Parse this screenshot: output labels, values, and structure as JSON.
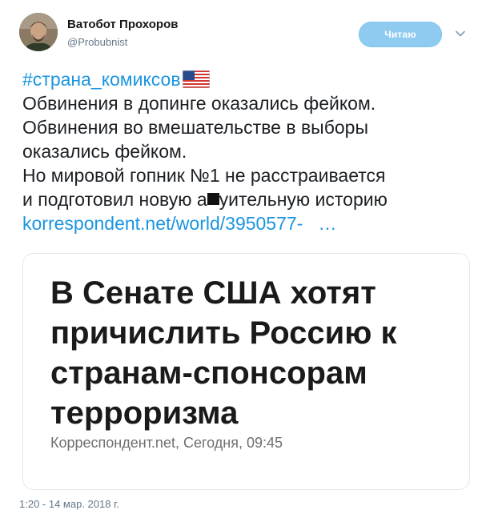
{
  "author": {
    "name": "Ватобот Прохоров",
    "handle": "@Probubnist",
    "follow_label": "Читаю"
  },
  "tweet": {
    "hashtag": "#страна_комиксов",
    "flag_icon": "us-flag-emoji",
    "lines": [
      "Обвинения в допинге оказались фейком.",
      "Обвинения во вмешательстве в выборы",
      "оказались фейком.",
      "Но мировой гопник №1 не расстраивается",
      "и подготовил новую а",
      "уительную историю"
    ],
    "link_text": "korrespondent.net/world/3950577-",
    "link_ellipsis": "…"
  },
  "card": {
    "title": "В Сенате США хотят причислить Россию к странам-спонсорам терроризма",
    "meta": "Корреспондент.net, Сегодня, 09:45"
  },
  "timestamp": "1:20 - 14 мар. 2018 г.",
  "colors": {
    "link": "#1b95e0",
    "follow_button": "#8fcbf1",
    "text": "#14171a",
    "muted": "#657786"
  }
}
